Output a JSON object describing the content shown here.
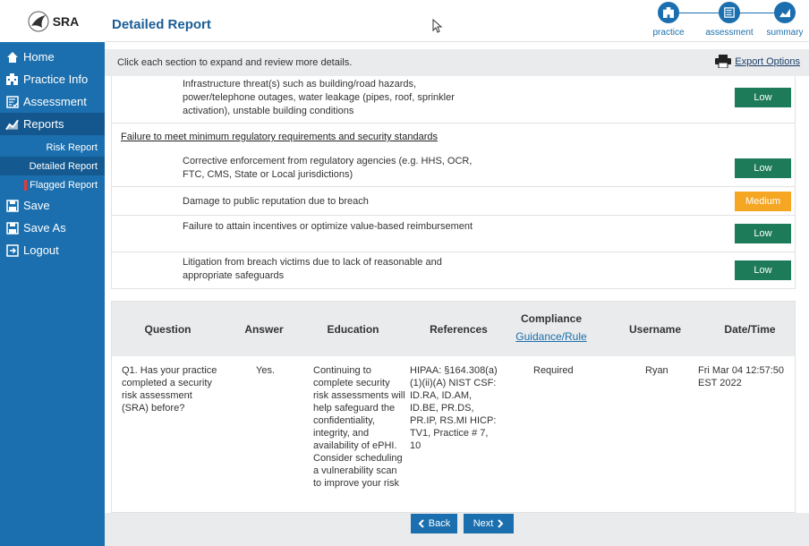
{
  "sidebar": {
    "logo_text": "SRA",
    "nav": [
      {
        "label": "Home",
        "icon": "home-icon"
      },
      {
        "label": "Practice Info",
        "icon": "building-icon"
      },
      {
        "label": "Assessment",
        "icon": "checklist-icon"
      },
      {
        "label": "Reports",
        "icon": "chart-icon"
      }
    ],
    "sub": [
      {
        "label": "Risk Report"
      },
      {
        "label": "Detailed Report"
      },
      {
        "label": "Flagged Report"
      }
    ],
    "bottom": [
      {
        "label": "Save",
        "icon": "save-icon"
      },
      {
        "label": "Save As",
        "icon": "save-as-icon"
      },
      {
        "label": "Logout",
        "icon": "logout-icon"
      }
    ]
  },
  "header": {
    "title": "Detailed Report",
    "steps": [
      {
        "label": "practice",
        "icon": "building-icon"
      },
      {
        "label": "assessment",
        "icon": "checklist-icon"
      },
      {
        "label": "summary",
        "icon": "chart-icon"
      }
    ]
  },
  "infobar": {
    "text": "Click each section to expand and review more details.",
    "export": "Export Options"
  },
  "risks": {
    "top_item": {
      "text": "Infrastructure threat(s) such as building/road hazards, power/telephone outages, water leakage (pipes, roof, sprinkler activation), unstable building conditions",
      "level": "Low"
    },
    "section_title": "Failure to meet minimum regulatory requirements and security standards",
    "items": [
      {
        "text": "Corrective enforcement from regulatory agencies (e.g. HHS, OCR, FTC, CMS, State or Local jurisdictions)",
        "level": "Low"
      },
      {
        "text": "Damage to public reputation due to breach",
        "level": "Medium"
      },
      {
        "text": "Failure to attain incentives or optimize value-based reimbursement",
        "level": "Low"
      },
      {
        "text": "Litigation from breach victims due to lack of reasonable and appropriate safeguards",
        "level": "Low"
      }
    ]
  },
  "table": {
    "headers": {
      "question": "Question",
      "answer": "Answer",
      "education": "Education",
      "references": "References",
      "compliance": "Compliance",
      "compliance_link": "Guidance/Rule",
      "username": "Username",
      "datetime": "Date/Time"
    },
    "row": {
      "question": "Q1. Has your practice completed a security risk assessment (SRA) before?",
      "answer": "Yes.",
      "education": "Continuing to complete security risk assessments will help safeguard the confidentiality, integrity, and availability of ePHI. Consider scheduling a vulnerability scan to improve your risk",
      "references": "HIPAA: §164.308(a)(1)(ii)(A) NIST CSF: ID.RA, ID.AM, ID.BE, PR.DS, PR.IP, RS.MI HICP: TV1, Practice # 7, 10",
      "compliance": "Required",
      "username": "Ryan",
      "datetime": "Fri Mar 04 12:57:50 EST 2022"
    }
  },
  "footer": {
    "back": "Back",
    "next": "Next"
  },
  "colors": {
    "sidebar": "#1b6fae",
    "low": "#1e7b5a",
    "medium": "#f5a623"
  }
}
